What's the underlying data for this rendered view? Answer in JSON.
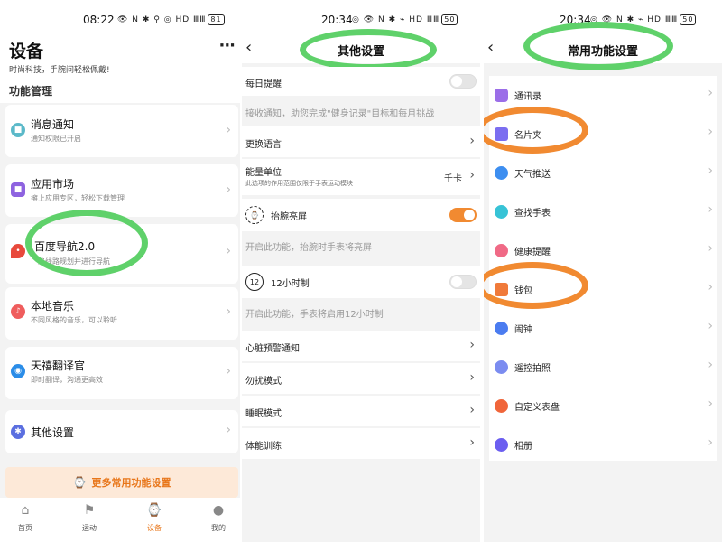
{
  "panel1": {
    "status": {
      "time": "08:22",
      "icons": "👁 N ✱ ⚲ ◎ HD ⅢⅢ",
      "battery": "81"
    },
    "title": "设备",
    "subtitle": "时尚科技，手腕间轻松佩戴!",
    "more": "···",
    "section": "功能管理",
    "items": [
      {
        "title": "消息通知",
        "subtitle": "通知权限已开启",
        "color": "#5bb9c9"
      },
      {
        "title": "应用市场",
        "subtitle": "擁上应用专区，轻松下载管理",
        "color": "#8e63e0"
      },
      {
        "title": "百度导航2.0",
        "subtitle": "路线路规划并进行导航",
        "color": "#e8493c"
      },
      {
        "title": "本地音乐",
        "subtitle": "不同风格的音乐，可以聆听",
        "color": "#ef5d5d"
      },
      {
        "title": "天禧翻译官",
        "subtitle": "即时翻译，沟通更高效",
        "color": "#2b8de8"
      },
      {
        "title": "其他设置",
        "subtitle": "",
        "color": "#5b6fe0"
      }
    ],
    "cta": "更多常用功能设置",
    "tabs": [
      {
        "label": "首页",
        "icon": "⌂"
      },
      {
        "label": "运动",
        "icon": "⚑"
      },
      {
        "label": "设备",
        "icon": "⌚"
      },
      {
        "label": "我的",
        "icon": "●"
      }
    ],
    "accent": "#e8761a",
    "highlight_color": "#5fd16a"
  },
  "panel2": {
    "status": {
      "time": "20:34",
      "icons": "◎ 👁 N ✱ ⌁ HD ⅢⅢ",
      "battery": "50"
    },
    "title": "其他设置",
    "rows": [
      {
        "label": "每日提醒",
        "kind": "toggle",
        "on": false
      },
      {
        "hint": "接收通知，助您完成\"健身记录\"目标和每月挑战"
      },
      {
        "label": "更换语言",
        "kind": "chevron"
      },
      {
        "label": "能量单位",
        "sub": "此选项的作用范围仅限于手表运动模块",
        "value": "千卡",
        "kind": "chevron"
      },
      {
        "label": "抬腕亮屏",
        "kind": "toggle",
        "on": true
      },
      {
        "hint": "开启此功能，抬腕时手表将亮屏"
      },
      {
        "label": "12小时制",
        "icon_text": "12",
        "kind": "toggle",
        "on": false
      },
      {
        "hint": "开启此功能，手表将启用12小时制"
      },
      {
        "label": "心脏预警通知",
        "kind": "chevron"
      },
      {
        "label": "勿扰模式",
        "kind": "chevron"
      },
      {
        "label": "睡眠模式",
        "kind": "chevron"
      },
      {
        "label": "体能训练",
        "kind": "chevron"
      }
    ],
    "highlight_color": "#5fd16a"
  },
  "panel3": {
    "status": {
      "time": "20:34",
      "icons": "◎ 👁 N ✱ ⌁ HD ⅢⅢ",
      "battery": "50"
    },
    "title": "常用功能设置",
    "items": [
      {
        "label": "通讯录",
        "color": "#9b6ee8"
      },
      {
        "label": "名片夹",
        "color": "#7b6ef0"
      },
      {
        "label": "天气推送",
        "color": "#3d8ef0"
      },
      {
        "label": "查找手表",
        "color": "#37c3d6"
      },
      {
        "label": "健康提醒",
        "color": "#f06a86"
      },
      {
        "label": "钱包",
        "color": "#f07a3a"
      },
      {
        "label": "闹钟",
        "color": "#4b7cf0"
      },
      {
        "label": "遥控拍照",
        "color": "#7b8cf0"
      },
      {
        "label": "自定义表盘",
        "color": "#f0653a"
      },
      {
        "label": "相册",
        "color": "#6b5ef0"
      }
    ],
    "highlight_green": "#5fd16a",
    "highlight_orange": "#f18a31"
  }
}
